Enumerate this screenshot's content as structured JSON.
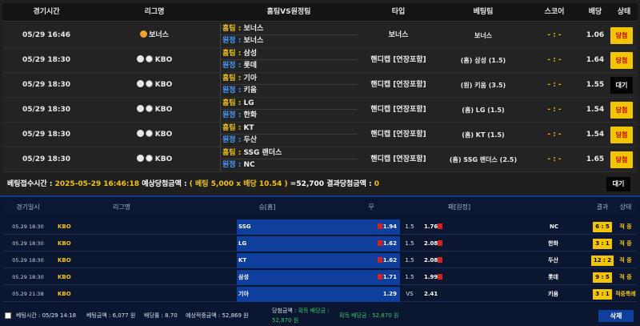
{
  "top": {
    "headers": [
      "경기시간",
      "리그명",
      "홈팀VS원정팀",
      "타입",
      "베팅팀",
      "스코어",
      "배당",
      "상태"
    ],
    "home_label": "홈팀 :",
    "away_label": "원정 :",
    "rows": [
      {
        "time": "05/29 16:46",
        "league": "보너스",
        "home": "보너스",
        "away": "보너스",
        "type": "보너스",
        "pick": "보너스",
        "score": "- : -",
        "rate": "1.06",
        "status": "당첨",
        "status_kind": "win"
      },
      {
        "time": "05/29 18:30",
        "league": "KBO",
        "home": "삼성",
        "away": "롯데",
        "type": "핸디캡 [연장포함]",
        "pick": "(홈) 삼성 (1.5)",
        "score": "- : -",
        "rate": "1.64",
        "status": "당첨",
        "status_kind": "win"
      },
      {
        "time": "05/29 18:30",
        "league": "KBO",
        "home": "기아",
        "away": "키움",
        "type": "핸디캡 [연장포함]",
        "pick": "(원) 키움 (3.5)",
        "score": "- : -",
        "rate": "1.55",
        "status": "대기",
        "status_kind": "wait"
      },
      {
        "time": "05/29 18:30",
        "league": "KBO",
        "home": "LG",
        "away": "한화",
        "type": "핸디캡 [연장포함]",
        "pick": "(홈) LG (1.5)",
        "score": "- : -",
        "rate": "1.54",
        "status": "당첨",
        "status_kind": "win"
      },
      {
        "time": "05/29 18:30",
        "league": "KBO",
        "home": "KT",
        "away": "두산",
        "type": "핸디캡 [연장포함]",
        "pick": "(홈) KT (1.5)",
        "score": "- : -",
        "rate": "1.54",
        "status": "당첨",
        "status_kind": "win"
      },
      {
        "time": "05/29 18:30",
        "league": "KBO",
        "home": "SSG 랜더스",
        "away": "NC",
        "type": "핸디캡 [연장포함]",
        "pick": "(홈) SSG 랜더스 (2.5)",
        "score": "- : -",
        "rate": "1.65",
        "status": "당첨",
        "status_kind": "win"
      }
    ],
    "summary": {
      "label1": "베팅접수시간 :",
      "time": "2025-05-29 16:46:18",
      "label2": "예상당첨금액 :",
      "calc": "( 베팅 5,000 x 배당 10.54 )",
      "expected": "=52,700",
      "label3": "결과당첨금액 :",
      "result": "0",
      "status": "대기"
    }
  },
  "bottom": {
    "headers": [
      "경기일시",
      "리그명",
      "승[홈]",
      "무",
      "패[원정]",
      "결과",
      "상태"
    ],
    "rows": [
      {
        "time": "05.29 18:30",
        "league": "KBO",
        "home": "SSG",
        "hrate": "1.94",
        "draw": "1.5",
        "arate": "1.76",
        "away": "NC",
        "result": "6 : 5",
        "status": "적 중"
      },
      {
        "time": "05.29 18:30",
        "league": "KBO",
        "home": "LG",
        "hrate": "1.62",
        "draw": "1.5",
        "arate": "2.08",
        "away": "한화",
        "result": "3 : 1",
        "status": "적 중"
      },
      {
        "time": "05.29 18:30",
        "league": "KBO",
        "home": "KT",
        "hrate": "1.62",
        "draw": "1.5",
        "arate": "2.08",
        "away": "두산",
        "result": "12 : 2",
        "status": "적 중"
      },
      {
        "time": "05.29 18:30",
        "league": "KBO",
        "home": "삼성",
        "hrate": "1.71",
        "draw": "1.5",
        "arate": "1.99",
        "away": "롯데",
        "result": "9 : 5",
        "status": "적 중"
      },
      {
        "time": "05.29 21:38",
        "league": "KBO",
        "home": "기아",
        "hrate": "1.29",
        "draw": "VS",
        "arate": "2.41",
        "away": "키움",
        "result": "3 : 1",
        "status": "적중특례"
      }
    ],
    "footer": {
      "bet_time": "베팅시간 : 05/29 14:18",
      "bet_amount": "베팅금액 : 6,077 원",
      "rate": "배당률 : 8.70",
      "expected": "예상적중금액 : 52,869 원",
      "win_amount_label": "당첨금액 :",
      "win_amount_sub": "획득 배당금 :",
      "win_amount": "52,870 원",
      "win_amount_right": "획득 배당금 : 52,870 원",
      "delete": "삭제"
    }
  }
}
